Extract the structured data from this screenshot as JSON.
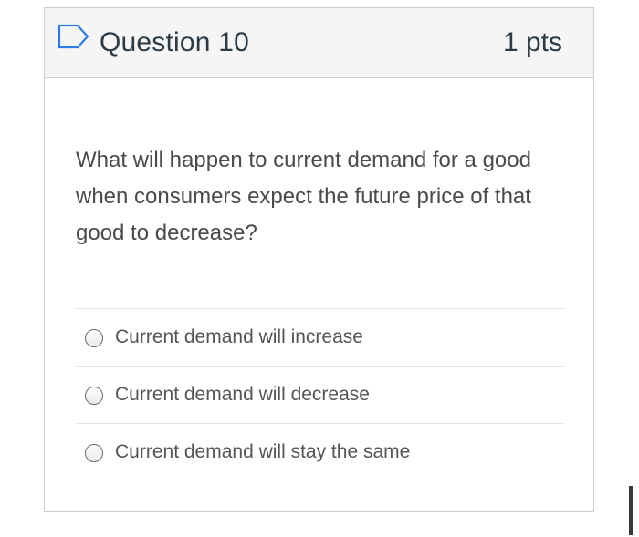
{
  "question": {
    "title": "Question 10",
    "points": "1 pts",
    "flag_icon": "flag-outline-icon",
    "text": "What will happen to current demand for a good when consumers expect the future price of that good to decrease?",
    "answers": [
      {
        "label": "Current demand will increase",
        "selected": false
      },
      {
        "label": "Current demand will decrease",
        "selected": false
      },
      {
        "label": "Current demand will stay the same",
        "selected": false
      }
    ]
  },
  "colors": {
    "header_bg": "#f5f5f5",
    "border": "#c7cdd1",
    "flag": "#2d7be6",
    "text": "#2d3b45"
  }
}
